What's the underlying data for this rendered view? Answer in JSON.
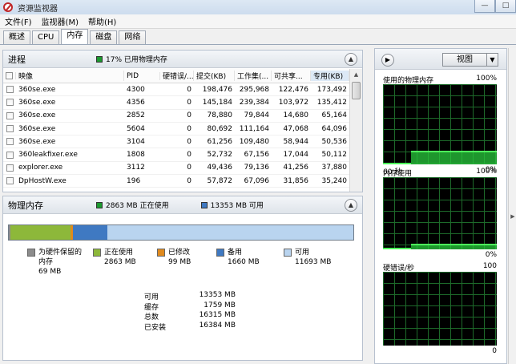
{
  "window": {
    "title": "资源监视器",
    "min_label": "—",
    "max_label": "□"
  },
  "menu": [
    "文件(F)",
    "监视器(M)",
    "帮助(H)"
  ],
  "tabs": [
    "概述",
    "CPU",
    "内存",
    "磁盘",
    "网络"
  ],
  "active_tab": 2,
  "processes": {
    "title": "进程",
    "status_text": "17% 已用物理内存",
    "status_color": "#1c9a2f",
    "columns": [
      "映像",
      "PID",
      "硬错误/...",
      "提交(KB)",
      "工作集(...",
      "可共享...",
      "专用(KB)"
    ],
    "rows": [
      {
        "name": "360se.exe",
        "pid": "4300",
        "hard_faults": "0",
        "commit": "198,476",
        "working_set": "295,968",
        "shareable": "122,476",
        "private": "173,492"
      },
      {
        "name": "360se.exe",
        "pid": "4356",
        "hard_faults": "0",
        "commit": "145,184",
        "working_set": "239,384",
        "shareable": "103,972",
        "private": "135,412"
      },
      {
        "name": "360se.exe",
        "pid": "2852",
        "hard_faults": "0",
        "commit": "78,880",
        "working_set": "79,844",
        "shareable": "14,680",
        "private": "65,164"
      },
      {
        "name": "360se.exe",
        "pid": "5604",
        "hard_faults": "0",
        "commit": "80,692",
        "working_set": "111,164",
        "shareable": "47,068",
        "private": "64,096"
      },
      {
        "name": "360se.exe",
        "pid": "3104",
        "hard_faults": "0",
        "commit": "61,256",
        "working_set": "109,480",
        "shareable": "58,944",
        "private": "50,536"
      },
      {
        "name": "360leakfixer.exe",
        "pid": "1808",
        "hard_faults": "0",
        "commit": "52,732",
        "working_set": "67,156",
        "shareable": "17,044",
        "private": "50,112"
      },
      {
        "name": "explorer.exe",
        "pid": "3112",
        "hard_faults": "0",
        "commit": "49,436",
        "working_set": "79,136",
        "shareable": "41,256",
        "private": "37,880"
      },
      {
        "name": "DpHostW.exe",
        "pid": "196",
        "hard_faults": "0",
        "commit": "57,872",
        "working_set": "67,096",
        "shareable": "31,856",
        "private": "35,240"
      }
    ]
  },
  "physical_memory": {
    "title": "物理内存",
    "in_use_text": "2863 MB 正在使用",
    "available_text": "13353 MB 可用",
    "bar": [
      {
        "key": "reserved",
        "mb": 69,
        "color": "#8c8c8c"
      },
      {
        "key": "in_use",
        "mb": 2863,
        "color": "#8db83a"
      },
      {
        "key": "modified",
        "mb": 99,
        "color": "#e08a1e"
      },
      {
        "key": "standby",
        "mb": 1660,
        "color": "#3f79c2"
      },
      {
        "key": "free",
        "mb": 11693,
        "color": "#b9d4ef"
      }
    ],
    "legend": [
      {
        "label": "为硬件保留的内存",
        "value": "69 MB",
        "color": "#8c8c8c"
      },
      {
        "label": "正在使用",
        "value": "2863 MB",
        "color": "#8db83a"
      },
      {
        "label": "已修改",
        "value": "99 MB",
        "color": "#e08a1e"
      },
      {
        "label": "备用",
        "value": "1660 MB",
        "color": "#3f79c2"
      },
      {
        "label": "可用",
        "value": "11693 MB",
        "color": "#b9d4ef"
      }
    ],
    "summary": [
      {
        "label": "可用",
        "value": "13353 MB"
      },
      {
        "label": "缓存",
        "value": "1759 MB"
      },
      {
        "label": "总数",
        "value": "16315 MB"
      },
      {
        "label": "已安装",
        "value": "16384 MB"
      }
    ]
  },
  "right_panel": {
    "view_label": "视图",
    "graphs": [
      {
        "title": "使用的物理内存",
        "max": "100%",
        "foot_left": "60 秒",
        "foot_right": "0%",
        "level": 0.17
      },
      {
        "title": "内存使用",
        "max": "100%",
        "foot_left": "",
        "foot_right": "0%",
        "level": 0.08
      },
      {
        "title": "硬错误/秒",
        "max": "100",
        "foot_left": "",
        "foot_right": "0",
        "level": 0.0
      }
    ]
  }
}
